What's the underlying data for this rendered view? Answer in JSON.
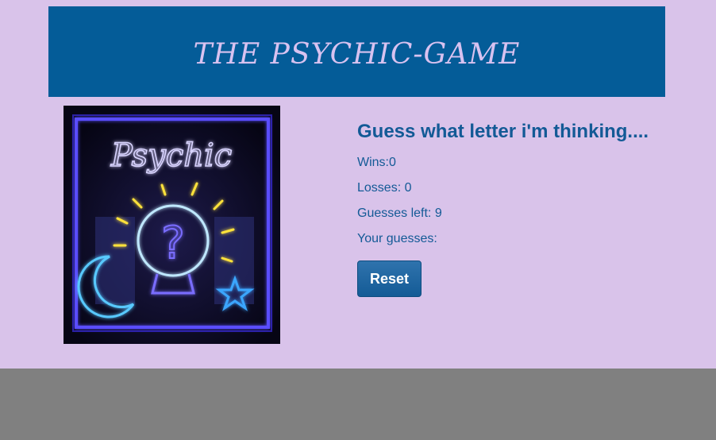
{
  "header": {
    "title": "THE PSYCHIC-GAME"
  },
  "image": {
    "sign_text": "Psychic",
    "symbol": "?"
  },
  "game": {
    "heading": "Guess what letter i'm thinking....",
    "wins_label": "Wins:",
    "wins": "0",
    "losses_label": "Losses: ",
    "losses": "0",
    "guesses_left_label": "Guesses left: ",
    "guesses_left": "9",
    "your_guesses_label": "Your guesses:",
    "your_guesses": "",
    "reset_label": "Reset"
  },
  "colors": {
    "page_bg": "#d9c3ea",
    "footer_bg": "#808080",
    "header_bg": "#045c98",
    "title_text": "#d8c2f0",
    "panel_text": "#135a96",
    "button_bg": "#1d649f"
  }
}
